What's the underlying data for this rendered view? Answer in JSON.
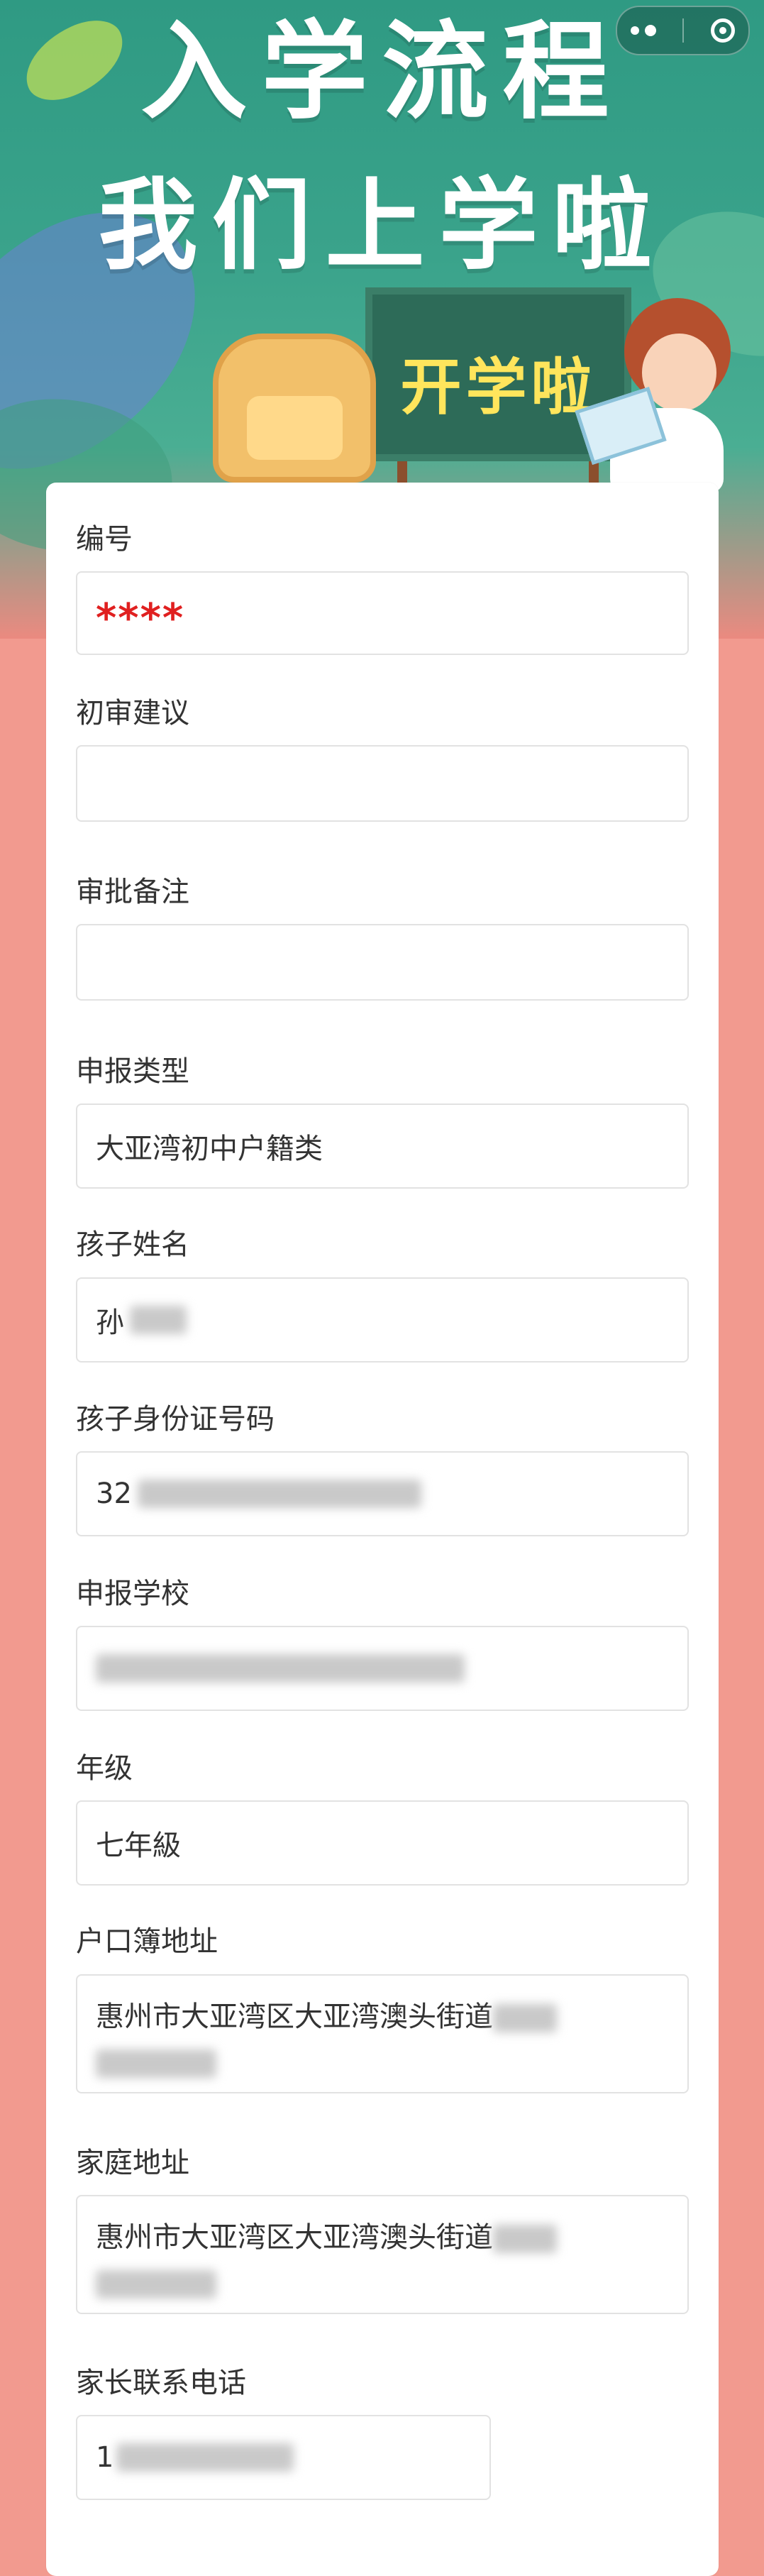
{
  "banner": {
    "title_line1": "入学流程",
    "title_line2": "我们上学啦",
    "board_text": "开学啦"
  },
  "capsule": {
    "more_icon": "more-dots-icon",
    "close_icon": "target-close-icon"
  },
  "colors": {
    "banner_green": "#3aa38b",
    "page_salmon": "#f29a8f",
    "label_text": "#333333",
    "red_value": "#e02020"
  },
  "form": {
    "fields": [
      {
        "label": "编号",
        "value": "****"
      },
      {
        "label": "初审建议",
        "value": ""
      },
      {
        "label": "审批备注",
        "value": ""
      },
      {
        "label": "申报类型",
        "value": "大亚湾初中户籍类"
      },
      {
        "label": "孩子姓名",
        "value": "孙"
      },
      {
        "label": "孩子身份证号码",
        "value": "32"
      },
      {
        "label": "申报学校",
        "value": ""
      },
      {
        "label": "年级",
        "value": "七年級"
      },
      {
        "label": "户口簿地址",
        "value": "惠州市大亚湾区大亚湾澳头街道"
      },
      {
        "label": "家庭地址",
        "value": "惠州市大亚湾区大亚湾澳头街道"
      },
      {
        "label": "家长联系电话",
        "value": "1"
      }
    ]
  }
}
